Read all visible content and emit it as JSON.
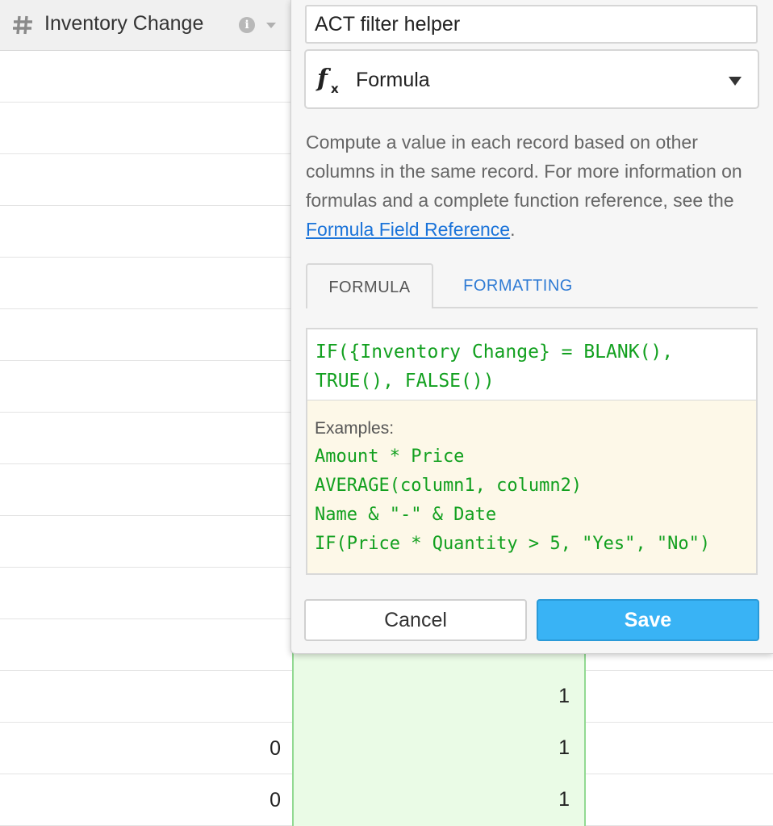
{
  "grid": {
    "column_header": {
      "icon": "hash-icon",
      "label": "Inventory Change",
      "info_icon": "i"
    },
    "rows": [
      {
        "inventory_change": "",
        "helper": ""
      },
      {
        "inventory_change": "",
        "helper": ""
      },
      {
        "inventory_change": "",
        "helper": ""
      },
      {
        "inventory_change": "",
        "helper": ""
      },
      {
        "inventory_change": "",
        "helper": ""
      },
      {
        "inventory_change": "",
        "helper": ""
      },
      {
        "inventory_change": "",
        "helper": ""
      },
      {
        "inventory_change": "",
        "helper": ""
      },
      {
        "inventory_change": "",
        "helper": ""
      },
      {
        "inventory_change": "",
        "helper": ""
      },
      {
        "inventory_change": "",
        "helper": ""
      },
      {
        "inventory_change": "",
        "helper": ""
      },
      {
        "inventory_change": "",
        "helper": "1"
      },
      {
        "inventory_change": "0",
        "helper": "1"
      },
      {
        "inventory_change": "0",
        "helper": "1"
      }
    ]
  },
  "field_config": {
    "name_value": "ACT filter helper",
    "type": {
      "icon": "fx-icon",
      "label": "Formula"
    },
    "description_text": "Compute a value in each record based on other columns in the same record. For more information on formulas and a complete function reference, see the ",
    "description_link": "Formula Field Reference",
    "description_end": ".",
    "tabs": {
      "formula": "FORMULA",
      "formatting": "FORMATTING"
    },
    "formula_value": "IF({Inventory Change} = BLANK(), TRUE(), FALSE())",
    "examples": {
      "title": "Examples:",
      "line_1": "Amount * Price",
      "line_2": "AVERAGE(column1, column2)",
      "line_3": "Name & \"-\" & Date",
      "line_4": "IF(Price * Quantity > 5, \"Yes\", \"No\")"
    },
    "buttons": {
      "cancel": "Cancel",
      "save": "Save"
    }
  },
  "colors": {
    "save_button": "#39b3f5",
    "link": "#1a73d9",
    "formula_text": "#12a01f",
    "selected_column": "#eafbe6",
    "examples_bg": "#fdf8e8"
  }
}
